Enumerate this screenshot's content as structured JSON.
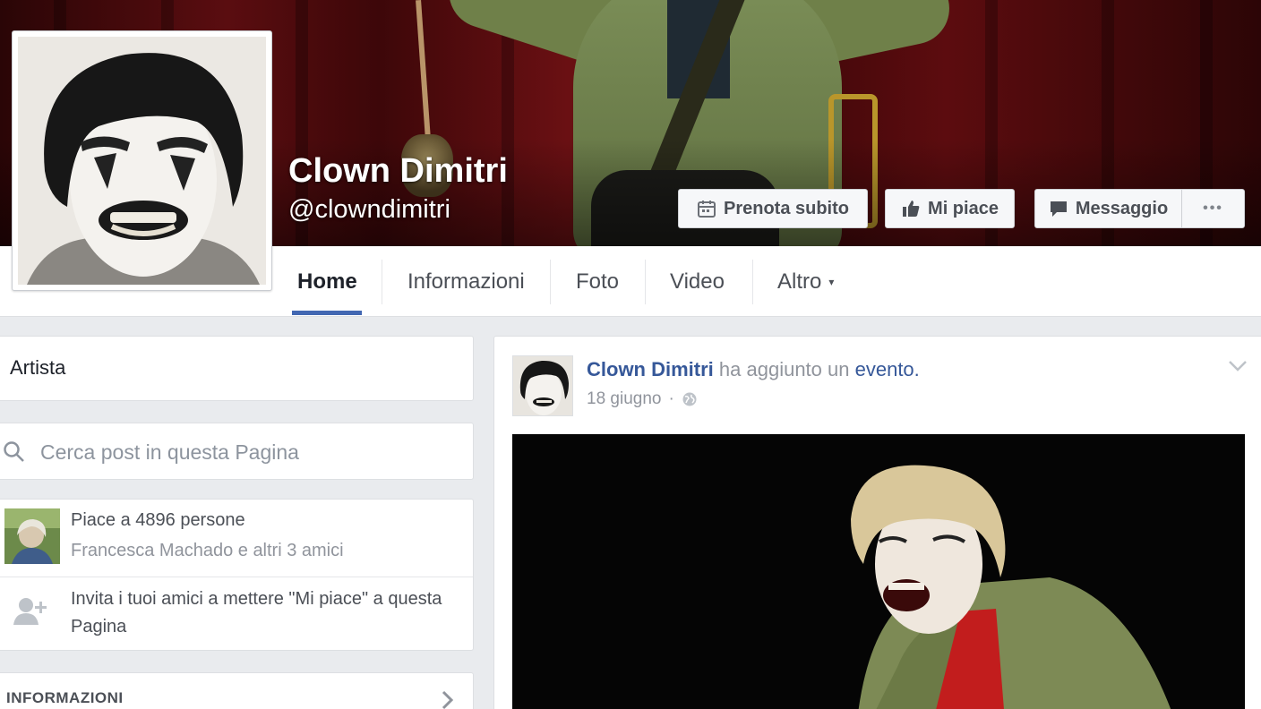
{
  "cover": {
    "page_name": "Clown Dimitri",
    "handle": "@clowndimitri",
    "buttons": {
      "book": "Prenota subito",
      "like": "Mi piace",
      "message": "Messaggio",
      "more": "•••"
    }
  },
  "nav": {
    "tabs": [
      "Home",
      "Informazioni",
      "Foto",
      "Video",
      "Altro"
    ],
    "active_tab": "Home",
    "more_caret": "▾"
  },
  "sidebar": {
    "category": "Artista",
    "search_placeholder": "Cerca post in questa Pagina",
    "likes": {
      "count_text": "Piace a 4896 persone",
      "friends_text": "Francesca Machado e altri 3 amici"
    },
    "invite_text": "Invita i tuoi amici a mettere \"Mi piace\" a questa Pagina",
    "info_title": "INFORMAZIONI"
  },
  "post": {
    "author": "Clown Dimitri",
    "action": "ha aggiunto un",
    "object": "evento.",
    "date": "18 giugno",
    "separator": "·"
  },
  "icons": {
    "calendar": "calendar-icon",
    "thumbs_up": "thumbs-up-icon",
    "message": "speech-bubble-icon",
    "search": "search-icon",
    "add_friend": "add-friend-icon",
    "globe": "globe-icon",
    "chevron_down": "chevron-down-icon",
    "chevron_right": "chevron-right-icon"
  },
  "colors": {
    "link_blue": "#365899",
    "active_tab_underline": "#4267b2",
    "background": "#e9ebee"
  }
}
